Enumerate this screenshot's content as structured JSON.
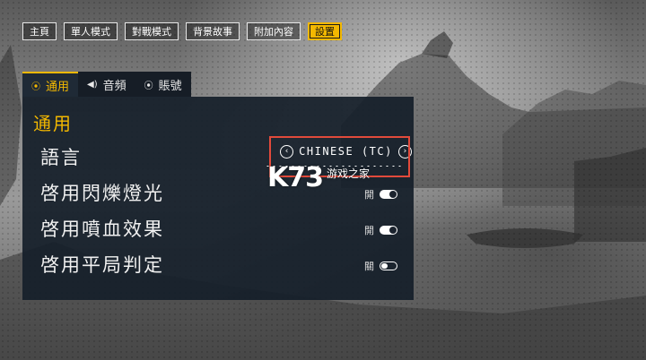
{
  "nav": {
    "items": [
      "主頁",
      "單人模式",
      "對戰模式",
      "背景故事",
      "附加內容",
      "設置"
    ],
    "active_index": 5
  },
  "tabs": [
    {
      "label": "通用",
      "icon": "gear-icon",
      "active": true
    },
    {
      "label": "音頻",
      "icon": "speaker-icon",
      "active": false
    },
    {
      "label": "賬號",
      "icon": "account-icon",
      "active": false
    }
  ],
  "settings": {
    "section_title": "通用",
    "language": {
      "label": "語言",
      "value": "CHINESE (TC)"
    },
    "rows": [
      {
        "label": "啓用閃爍燈光",
        "state_text": "開",
        "on": true
      },
      {
        "label": "啓用噴血效果",
        "state_text": "開",
        "on": true
      },
      {
        "label": "啓用平局判定",
        "state_text": "關",
        "on": false
      }
    ]
  },
  "watermark": {
    "logo": "K73",
    "sub": "游戏之家"
  },
  "colors": {
    "accent": "#f3b800",
    "panel": "#161f2a",
    "highlight": "#e24a3b"
  }
}
